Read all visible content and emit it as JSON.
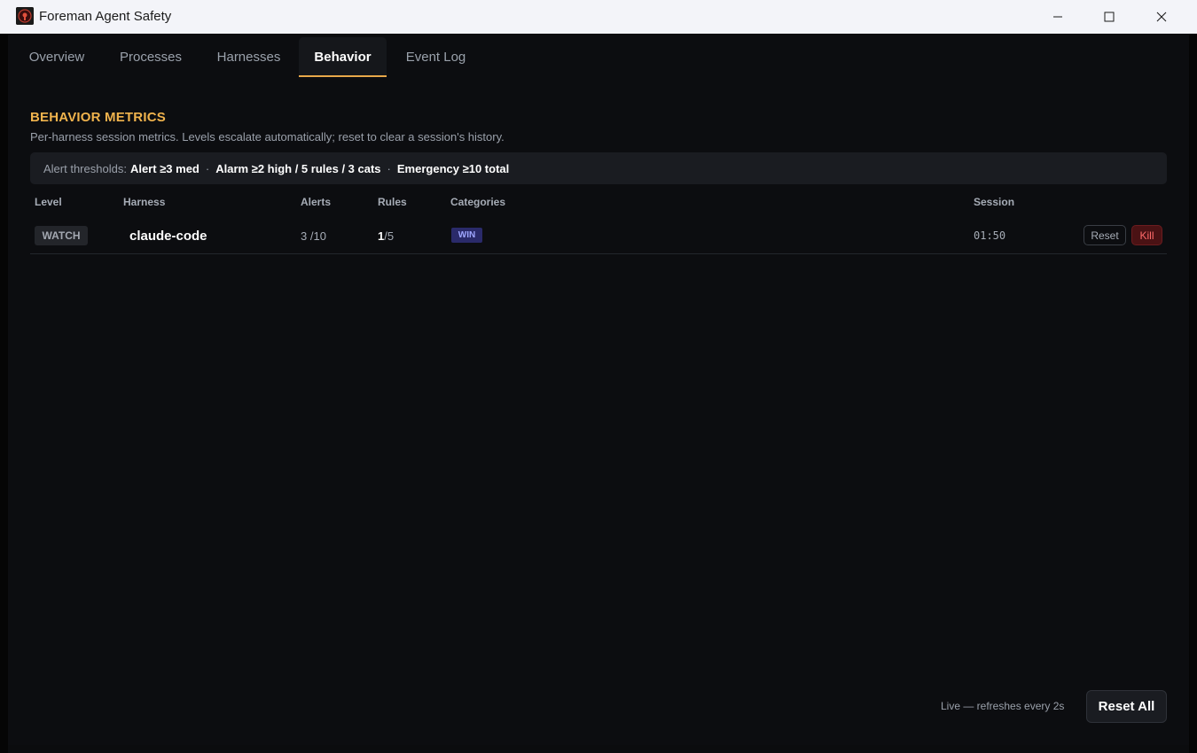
{
  "window": {
    "title": "Foreman Agent Safety",
    "icons": {
      "app": "foreman-shield-icon",
      "minimize": "minimize-icon",
      "maximize": "maximize-icon",
      "close": "close-icon"
    }
  },
  "tabs": [
    {
      "label": "Overview"
    },
    {
      "label": "Processes"
    },
    {
      "label": "Harnesses"
    },
    {
      "label": "Behavior",
      "active": true
    },
    {
      "label": "Event Log"
    }
  ],
  "behavior": {
    "title": "BEHAVIOR METRICS",
    "description": "Per-harness session metrics. Levels escalate automatically; reset to clear a session's history.",
    "thresholds": {
      "label": "Alert thresholds:",
      "alert": "Alert ≥3 med",
      "alarm": "Alarm ≥2 high / 5 rules / 3 cats",
      "emergency": "Emergency ≥10 total",
      "separator": "·"
    },
    "columns": {
      "level": "Level",
      "harness": "Harness",
      "alerts": "Alerts",
      "rules": "Rules",
      "categories": "Categories",
      "session": "Session"
    },
    "rows": [
      {
        "level": "WATCH",
        "harness": "claude-code",
        "alerts_count": "3",
        "alerts_total": "/10",
        "rules_count": "1",
        "rules_total": "/5",
        "category": "WIN",
        "session": "01:50",
        "reset_label": "Reset",
        "kill_label": "Kill"
      }
    ]
  },
  "footer": {
    "status": "Live — refreshes every 2s",
    "reset_all_label": "Reset All"
  },
  "colors": {
    "accent": "#e8a84a",
    "section_title": "#f0b34d",
    "kill": "#ff6a6a",
    "category_badge": "#2a2a6a"
  }
}
